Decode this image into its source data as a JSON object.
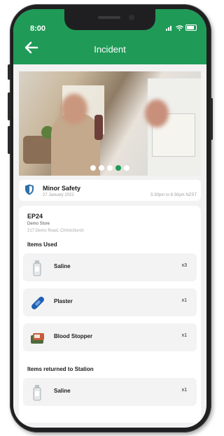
{
  "status_bar": {
    "time": "8:00",
    "signal_icon": "signal-icon",
    "wifi_icon": "wifi-icon",
    "battery_icon": "battery-icon"
  },
  "header": {
    "title": "Incident",
    "back_icon": "arrow-left-icon",
    "color": "#1f9b57"
  },
  "carousel": {
    "count": 5,
    "active_index": 3
  },
  "summary": {
    "severity": "Minor Safety",
    "date": "27 January 2022",
    "time_range": "5:30pm to 6:30pm NZST",
    "icon": "shield-icon"
  },
  "location": {
    "code": "EP24",
    "store": "Demo Store",
    "address": "217 Demo Road, Christchurch"
  },
  "items_used_title": "Items Used",
  "items_used": [
    {
      "name": "Saline",
      "qty": "x3",
      "icon": "saline-bottle-icon"
    },
    {
      "name": "Plaster",
      "qty": "x1",
      "icon": "plaster-icon"
    },
    {
      "name": "Blood Stopper",
      "qty": "x1",
      "icon": "blood-stopper-icon"
    }
  ],
  "items_returned_title": "Items returned to Station",
  "items_returned": [
    {
      "name": "Saline",
      "qty": "x1",
      "icon": "saline-bottle-icon"
    }
  ]
}
